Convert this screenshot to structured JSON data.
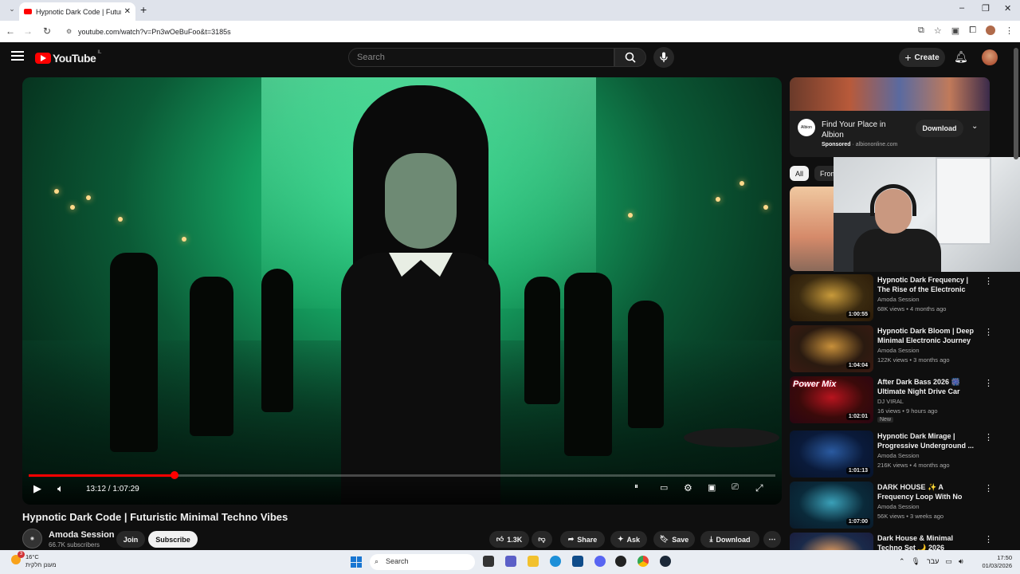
{
  "browser": {
    "tab_title": "Hypnotic Dark Code | Futuristic",
    "tab_close": "✕",
    "new_tab": "+",
    "url": "youtube.com/watch?v=Pn3wOeBuFoo&t=3185s",
    "window": {
      "minimize": "–",
      "restore": "❐",
      "close": "✕"
    }
  },
  "header": {
    "logo_text": "YouTube",
    "country_code": "IL",
    "search_placeholder": "Search",
    "create_label": "Create"
  },
  "player": {
    "current_time": "13:12",
    "duration": "1:07:29",
    "progress_fraction": 0.1956,
    "buffer_fraction": 0.21
  },
  "video": {
    "title": "Hypnotic Dark Code | Futuristic Minimal Techno Vibes",
    "channel": "Amoda Session",
    "subscribers": "66.7K subscribers",
    "join_label": "Join",
    "subscribe_label": "Subscribe",
    "likes": "1.3K",
    "share_label": "Share",
    "ask_label": "Ask",
    "save_label": "Save",
    "download_label": "Download"
  },
  "ad": {
    "title": "Find Your Place in Albion",
    "sponsored": "Sponsored",
    "domain": "albiononline.com",
    "cta": "Download",
    "logo_text": "Albion"
  },
  "chips": [
    "All",
    "From"
  ],
  "recommendations": [
    {
      "title": "Hypnotic Dark Frequency | The Rise of the Electronic Mind",
      "channel": "Amoda Session",
      "meta": "68K views • 4 months ago",
      "duration": "1:00:55",
      "colors": [
        "#3a2a10",
        "#c89a3a",
        "#2a1a08"
      ]
    },
    {
      "title": "Hypnotic Dark Bloom | Deep Minimal Electronic Journey",
      "channel": "Amoda Session",
      "meta": "122K views • 3 months ago",
      "duration": "1:04:04",
      "colors": [
        "#2a1a10",
        "#c8903a",
        "#3a1a12"
      ]
    },
    {
      "title": "After Dark Bass 2026 🎆 Ultimate Night Drive Car Musi...",
      "channel": "DJ VIRAL",
      "meta": "16 views • 9 hours ago",
      "badge": "New",
      "duration": "1:02:01",
      "colors": [
        "#3a0a0a",
        "#b8141e",
        "#2a0612"
      ]
    },
    {
      "title": "Hypnotic Dark Mirage | Progressive Underground ...",
      "channel": "Amoda Session",
      "meta": "216K views • 4 months ago",
      "duration": "1:01:13",
      "colors": [
        "#0a1a3a",
        "#2a5aa0",
        "#08142a"
      ]
    },
    {
      "title": "DARK HOUSE ✨ A Frequency Loop With No Morning",
      "channel": "Amoda Session",
      "meta": "56K views • 3 weeks ago",
      "duration": "1:07:00",
      "colors": [
        "#0a2a3a",
        "#3aa0b8",
        "#0a1a2a"
      ]
    },
    {
      "title": "Dark House & Minimal Techno Set 🌙 2026",
      "channel": "",
      "meta": "",
      "duration": "",
      "colors": [
        "#1a2a4a",
        "#e8a060",
        "#1a1a3a"
      ]
    }
  ],
  "thumb_overlay_text": "Power Mix",
  "taskbar": {
    "temp": "16°C",
    "weather_desc": "מעונן חלקית",
    "weather_badge": "3",
    "search_label": "Search",
    "lang": "עבר",
    "time": "17:50",
    "date": "01/03/2026"
  }
}
